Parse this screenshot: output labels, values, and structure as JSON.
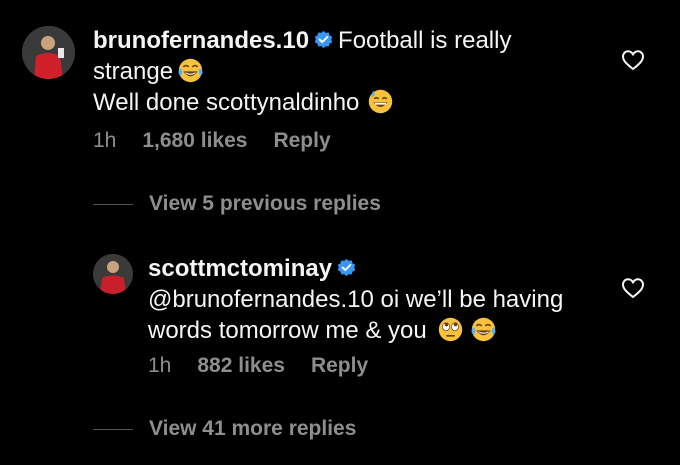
{
  "comments": [
    {
      "username": "brunofernandes.10",
      "text_line1": "Football is really",
      "text_line2": "strange",
      "text_line3": "Well done scottynaldinho",
      "emoji_1": "face-with-tears-of-joy",
      "emoji_2": "grinning-face-with-sweat",
      "time": "1h",
      "likes": "1,680 likes",
      "reply": "Reply",
      "verified": true
    },
    {
      "username": "scottmctominay",
      "text_line1": "@brunofernandes.10 oi we’ll be having",
      "text_line2": "words tomorrow me & you",
      "emoji_1": "face-with-rolling-eyes",
      "emoji_2": "face-with-tears-of-joy",
      "time": "1h",
      "likes": "882 likes",
      "reply": "Reply",
      "verified": true
    }
  ],
  "view_previous": "View 5 previous replies",
  "view_more": "View 41 more replies",
  "colors": {
    "background": "#000000",
    "text": "#f5f5f5",
    "secondary": "#8e8e8e",
    "verified": "#3897f0"
  }
}
